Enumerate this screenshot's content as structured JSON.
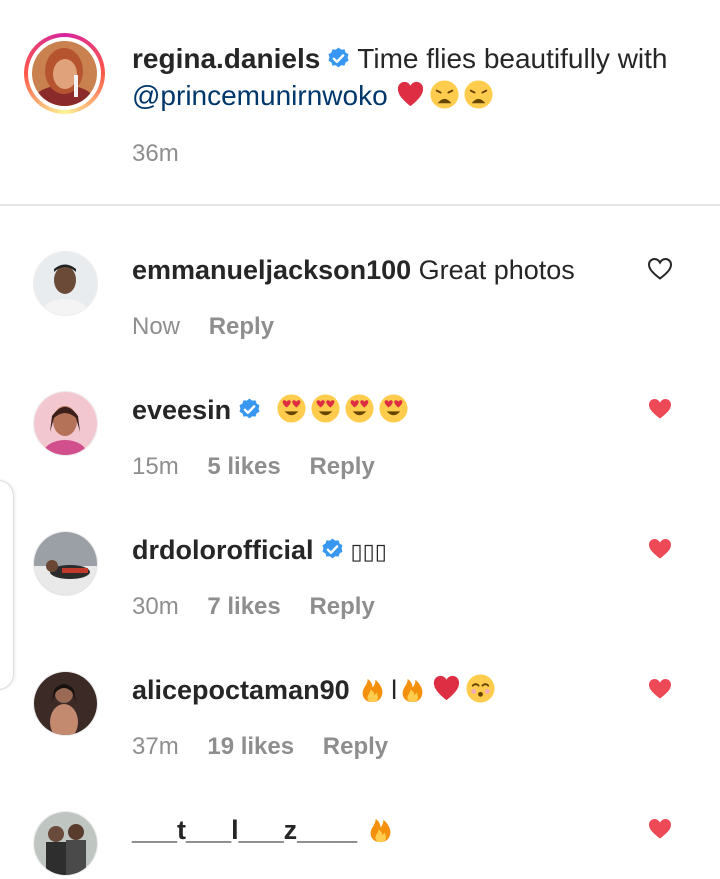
{
  "post": {
    "username": "regina.daniels",
    "verified": true,
    "caption_text": "Time flies beautifully with",
    "mention": "@princemunirnwoko",
    "caption_emojis": [
      "red-heart",
      "weary-face",
      "weary-face"
    ],
    "time": "36m"
  },
  "comments": [
    {
      "username": "emmanueljackson100",
      "verified": false,
      "text": "Great photos",
      "emojis": [],
      "time": "Now",
      "likes": "",
      "reply_label": "Reply",
      "liked": false
    },
    {
      "username": "eveesin",
      "verified": true,
      "text": "",
      "emojis": [
        "heart-eyes",
        "heart-eyes",
        "heart-eyes",
        "heart-eyes"
      ],
      "time": "15m",
      "likes": "5 likes",
      "reply_label": "Reply",
      "liked": true
    },
    {
      "username": "drdolorofficial",
      "verified": true,
      "text": "▯▯▯",
      "emojis": [],
      "time": "30m",
      "likes": "7 likes",
      "reply_label": "Reply",
      "liked": true
    },
    {
      "username": "alicepoctaman90",
      "verified": false,
      "text_parts": [
        "",
        "l",
        "",
        "",
        ""
      ],
      "emojis": [
        "fire",
        "fire",
        "red-heart",
        "kissing-face"
      ],
      "time": "37m",
      "likes": "19 likes",
      "reply_label": "Reply",
      "liked": true
    },
    {
      "username": "___t___l___z____",
      "verified": false,
      "text": "",
      "emojis": [
        "fire"
      ],
      "time": "",
      "likes": "",
      "reply_label": "",
      "liked": true
    }
  ],
  "colors": {
    "text": "#262626",
    "muted": "#8e8e8e",
    "mention": "#00376b",
    "verified_blue": "#3897f0",
    "liked_red": "#ed4956"
  }
}
